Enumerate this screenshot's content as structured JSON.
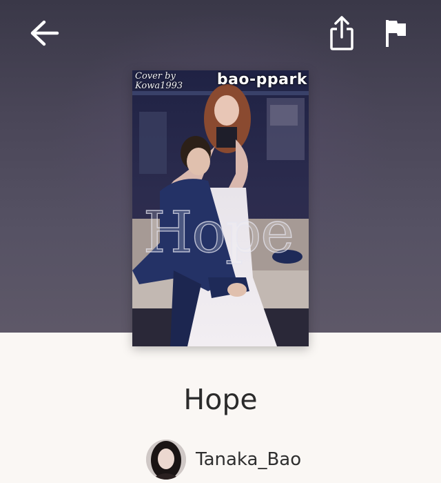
{
  "header": {
    "back_icon": "arrow-left-icon",
    "share_icon": "share-icon",
    "report_icon": "flag-icon",
    "icon_color": "#ffffff"
  },
  "cover": {
    "credit_line1": "Cover by",
    "credit_line2": "Kowa1993",
    "author_watermark": "bao-ppark",
    "title_overlay": "Hope"
  },
  "story": {
    "title": "Hope",
    "author": "Tanaka_Bao"
  },
  "colors": {
    "page_background": "#faf7f4",
    "header_background": "#4a4658",
    "title_text": "#2b2b2b"
  }
}
